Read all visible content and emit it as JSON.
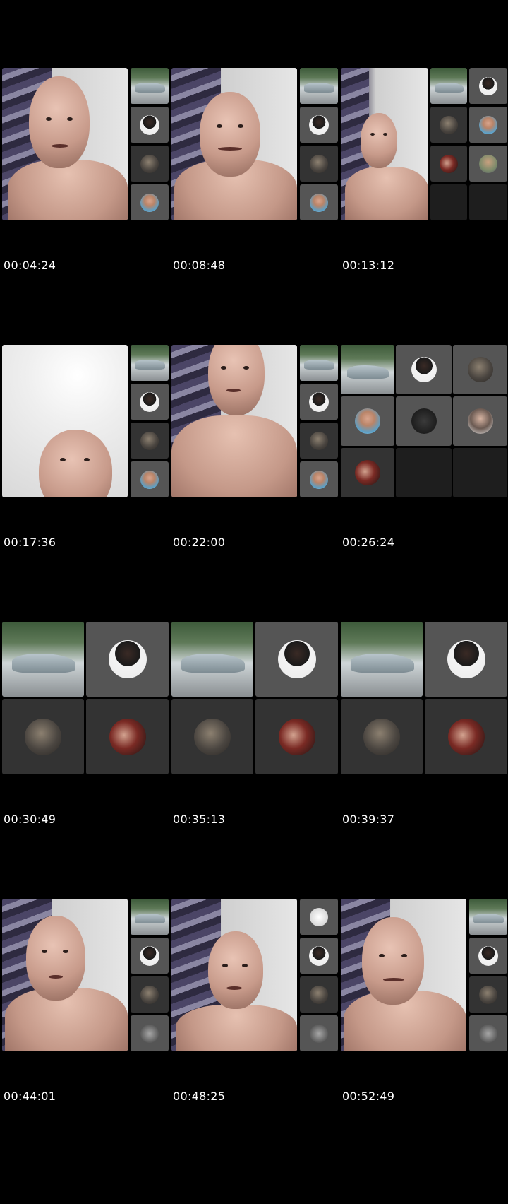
{
  "timestamps": [
    "00:04:24",
    "00:08:48",
    "00:13:12",
    "00:17:36",
    "00:22:00",
    "00:26:24",
    "00:30:49",
    "00:35:13",
    "00:39:37",
    "00:44:01",
    "00:48:25",
    "00:52:49"
  ],
  "icons": {
    "participant_avatars": [
      "woman-avatar-icon",
      "gray-avatar-icon",
      "man-avatar-icon",
      "couple-avatar-icon",
      "logo-avatar-icon",
      "guy-avatar-icon",
      "hooded-avatar-icon"
    ]
  },
  "colors": {
    "background": "#000000",
    "tile": "#555555",
    "tile_dark": "#333333",
    "empty_tile": "#1e1e1e",
    "text": "#ffffff"
  }
}
